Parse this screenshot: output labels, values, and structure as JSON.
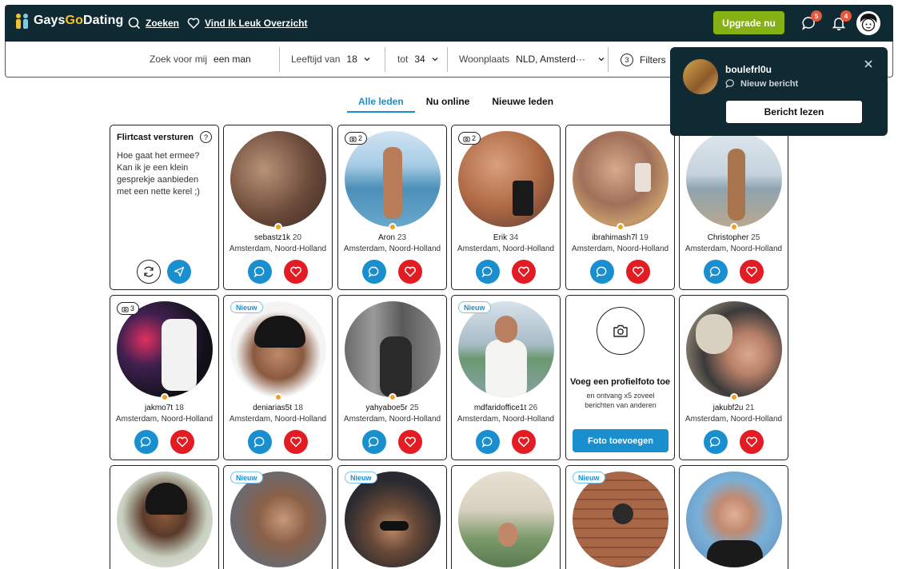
{
  "header": {
    "logo_main": "Gays",
    "logo_accent": "Go",
    "logo_rest": "Dating",
    "search_label": "Zoeken",
    "likes_label": "Vind Ik Leuk Overzicht",
    "upgrade_label": "Upgrade nu",
    "messages_count": "5",
    "notifications_count": "4"
  },
  "searchbar": {
    "looking_for_label": "Zoek voor mij",
    "looking_for_value": "een man",
    "age_label": "Leeftijd van",
    "age_from": "18",
    "age_to_label": "tot",
    "age_to": "34",
    "location_label": "Woonplaats",
    "location_value": "NLD, Amsterd···",
    "filters_count": "3",
    "filters_label": "Filters"
  },
  "tabs": [
    {
      "label": "Alle leden",
      "active": true
    },
    {
      "label": "Nu online",
      "active": false
    },
    {
      "label": "Nieuwe leden",
      "active": false
    }
  ],
  "notification": {
    "username": "boulefrl0u",
    "subtitle": "Nieuw bericht",
    "button": "Bericht lezen"
  },
  "flirtcast": {
    "title": "Flirtcast versturen",
    "help": "?",
    "message": "Hoe gaat het ermee? Kan ik je een klein gesprekje aanbieden met een nette kerel ;)"
  },
  "add_photo": {
    "title": "Voeg een profielfoto toe",
    "subtitle": "en ontvang x5 zoveel berichten van anderen",
    "button": "Foto toevoegen"
  },
  "new_tag_label": "Nieuw",
  "members": [
    {
      "name": "sebastz1k",
      "age": "20",
      "location": "Amsterdam, Noord-Holland",
      "photos": "",
      "is_new": false
    },
    {
      "name": "Aron",
      "age": "23",
      "location": "Amsterdam, Noord-Holland",
      "photos": "2",
      "is_new": false
    },
    {
      "name": "Erik",
      "age": "34",
      "location": "Amsterdam, Noord-Holland",
      "photos": "2",
      "is_new": false
    },
    {
      "name": "ibrahimash7l",
      "age": "19",
      "location": "Amsterdam, Noord-Holland",
      "photos": "",
      "is_new": false
    },
    {
      "name": "Christopher",
      "age": "25",
      "location": "Amsterdam, Noord-Holland",
      "photos": "",
      "is_new": true
    },
    {
      "name": "jakmo7t",
      "age": "18",
      "location": "Amsterdam, Noord-Holland",
      "photos": "3",
      "is_new": false
    },
    {
      "name": "deniarias5t",
      "age": "18",
      "location": "Amsterdam, Noord-Holland",
      "photos": "",
      "is_new": true
    },
    {
      "name": "yahyaboe5r",
      "age": "25",
      "location": "Amsterdam, Noord-Holland",
      "photos": "",
      "is_new": false
    },
    {
      "name": "mdfaridoffice1t",
      "age": "26",
      "location": "Amsterdam, Noord-Holland",
      "photos": "",
      "is_new": true
    },
    {
      "name": "jakubf2u",
      "age": "21",
      "location": "Amsterdam, Noord-Holland",
      "photos": "",
      "is_new": false
    }
  ],
  "colors": {
    "header_bg": "#0f2a33",
    "upgrade_green": "#86b114",
    "chat_blue": "#1a8fd0",
    "heart_red": "#e31b23",
    "online_orange": "#f0a020"
  }
}
